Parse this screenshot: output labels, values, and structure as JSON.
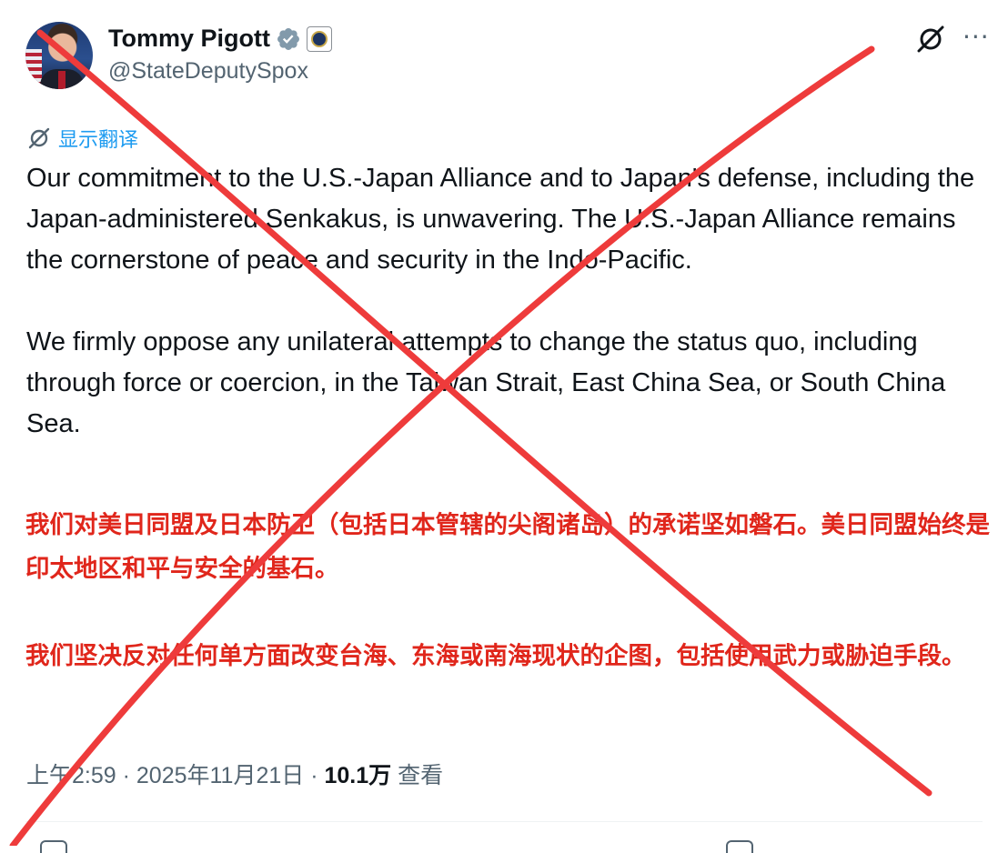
{
  "author": {
    "name": "Tommy Pigott",
    "handle": "@StateDeputySpox",
    "verified": true
  },
  "header_icons": [
    "grok-icon",
    "more-options-icon"
  ],
  "translate_link": {
    "label": "显示翻译",
    "icon": "grok-icon"
  },
  "tweet": {
    "en_paragraphs": [
      "Our commitment to the U.S.-Japan Alliance and to Japan's defense, including the Japan-administered Senkakus, is unwavering. The U.S.-Japan Alliance remains the cornerstone of peace and security in the Indo-Pacific.",
      "We firmly oppose any unilateral attempts to change the status quo, including through force or coercion, in the Taiwan Strait, East China Sea, or South China Sea."
    ],
    "zh_paragraphs": [
      "我们对美日同盟及日本防卫（包括日本管辖的尖阁诸岛）的承诺坚如磐石。美日同盟始终是印太地区和平与安全的基石。",
      "我们坚决反对任何单方面改变台海、东海或南海现状的企图，包括使用武力或胁迫手段。"
    ]
  },
  "meta": {
    "time": "上午2:59",
    "sep1": " · ",
    "date": "2025年11月21日",
    "sep2": " · ",
    "views": "10.1万",
    "views_label": " 查看"
  },
  "colors": {
    "text": "#0f1419",
    "secondary": "#536471",
    "link": "#1d9bf0",
    "annotation_red": "#e0261b",
    "cross_red": "#ee3b3b"
  }
}
